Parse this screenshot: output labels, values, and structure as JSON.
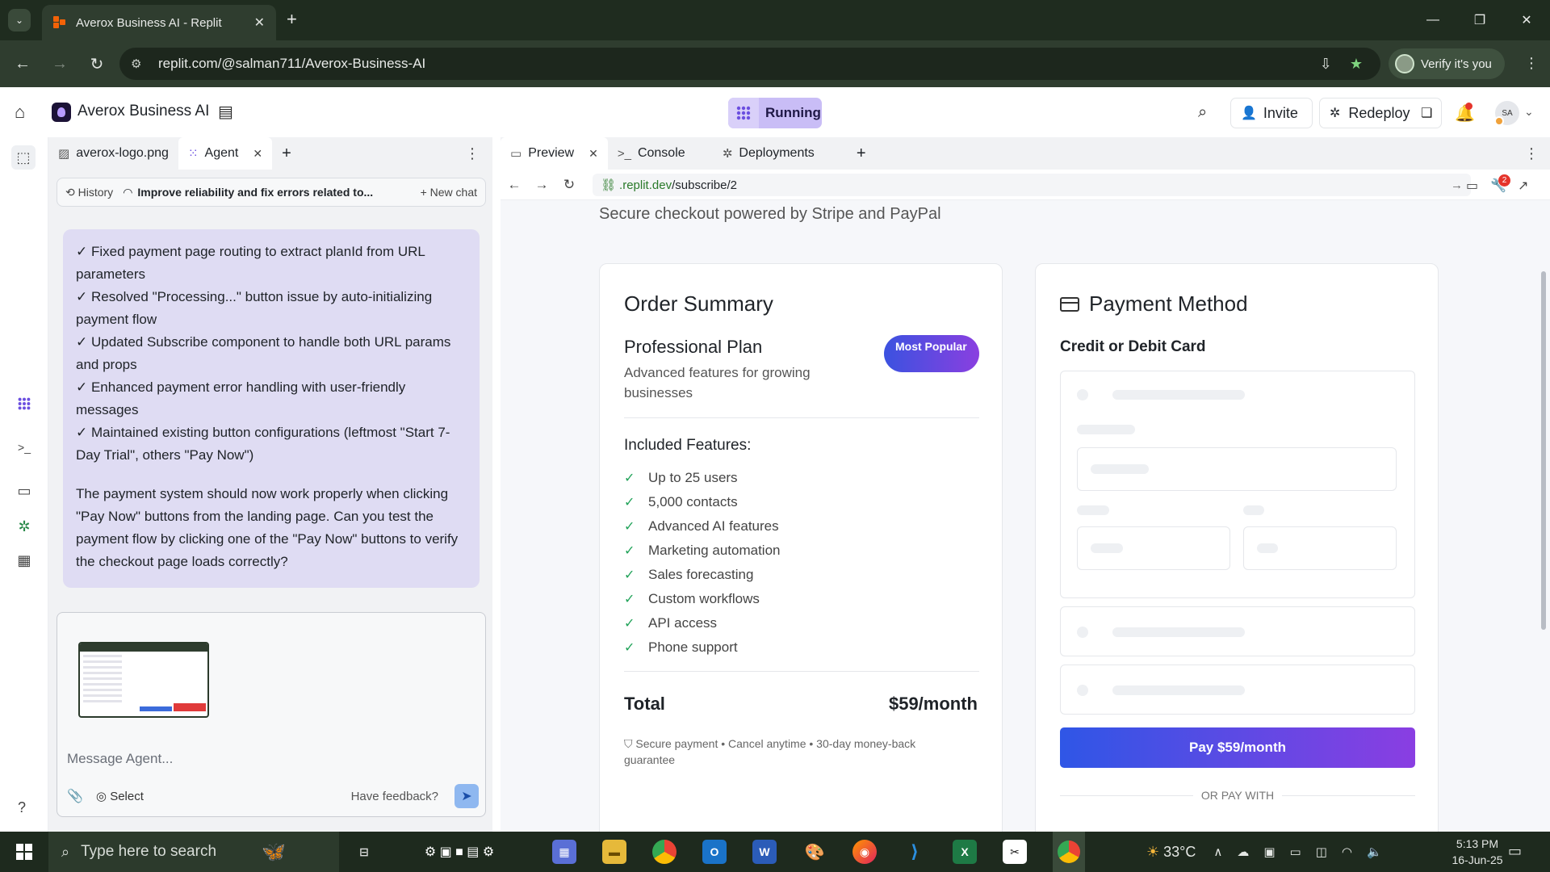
{
  "browser": {
    "tab_title": "Averox Business AI - Replit",
    "url": "replit.com/@salman711/Averox-Business-AI",
    "verify_label": "Verify it's you"
  },
  "header": {
    "repl_name": "Averox Business AI",
    "run_status": "Running",
    "invite_label": "Invite",
    "redeploy_label": "Redeploy",
    "avatar_initials": "SA"
  },
  "agent_tabs": [
    {
      "label": "averox-logo.png"
    },
    {
      "label": "Agent"
    }
  ],
  "history_bar": {
    "history_label": "History",
    "chat_title": "Improve reliability and fix errors related to...",
    "new_chat_label": "New chat"
  },
  "agent_message": {
    "lines": [
      "✓ Fixed payment page routing to extract planId from URL parameters",
      "✓ Resolved \"Processing...\" button issue by auto-initializing payment flow",
      "✓ Updated Subscribe component to handle both URL params and props",
      "✓ Enhanced payment error handling with user-friendly messages",
      "✓ Maintained existing button configurations (leftmost \"Start 7-Day Trial\", others \"Pay Now\")"
    ],
    "closing": "The payment system should now work properly when clicking \"Pay Now\" buttons from the landing page. Can you test the payment flow by clicking one of the \"Pay Now\" buttons to verify the checkout page loads correctly?"
  },
  "composer": {
    "placeholder": "Message Agent...",
    "select_label": "Select",
    "feedback_label": "Have feedback?"
  },
  "preview_tabs": [
    {
      "label": "Preview"
    },
    {
      "label": "Console"
    },
    {
      "label": "Deployments"
    }
  ],
  "preview_url": {
    "host": ".replit.dev",
    "path": "/subscribe/2"
  },
  "wrench_badge_count": "2",
  "checkout": {
    "subtitle": "Secure checkout powered by Stripe and PayPal",
    "order_summary": {
      "title": "Order Summary",
      "plan_name": "Professional Plan",
      "plan_desc": "Advanced features for growing businesses",
      "badge": "Most Popular",
      "features_title": "Included Features:",
      "features": [
        "Up to 25 users",
        "5,000 contacts",
        "Advanced AI features",
        "Marketing automation",
        "Sales forecasting",
        "Custom workflows",
        "API access",
        "Phone support"
      ],
      "total_label": "Total",
      "total_amount": "$59/month",
      "secure_note": "Secure payment • Cancel anytime • 30-day money-back guarantee"
    },
    "payment_method": {
      "title": "Payment Method",
      "card_label": "Credit or Debit Card",
      "pay_button": "Pay $59/month",
      "or_pay_with": "OR PAY WITH"
    }
  },
  "taskbar": {
    "search_placeholder": "Type here to search",
    "temperature": "33°C",
    "time": "5:13 PM",
    "date": "16-Jun-25"
  },
  "colors": {
    "running_button": "#c9bdf6",
    "agent_bubble": "#dfdcf3",
    "pay_gradient_start": "#2f56e6",
    "pay_gradient_end": "#8a3ee2",
    "check_green": "#22a35a"
  }
}
